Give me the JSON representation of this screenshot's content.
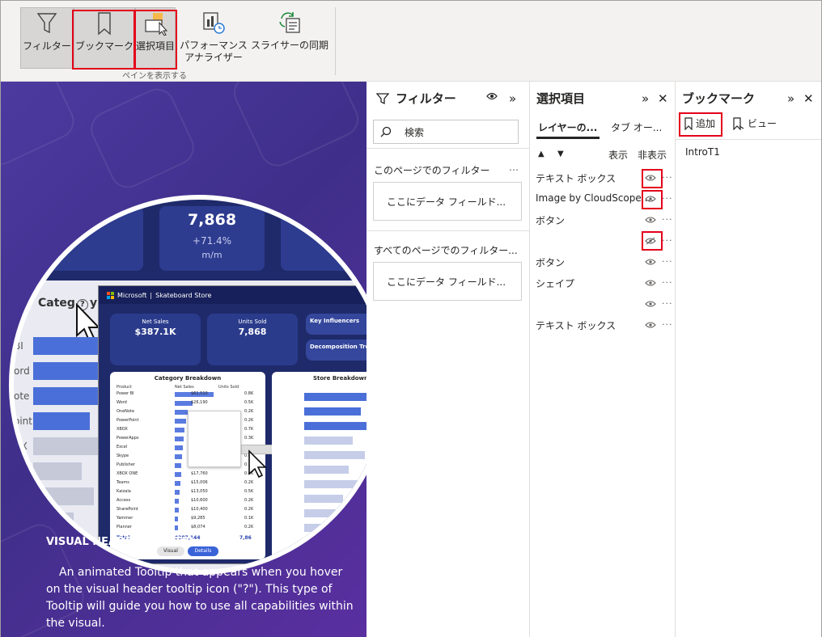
{
  "ribbon": {
    "buttons": [
      {
        "label": "フィルター"
      },
      {
        "label": "ブックマーク"
      },
      {
        "label": "選択項目"
      },
      {
        "label": "パフォーマンス",
        "label2": "アナライザー"
      },
      {
        "label": "スライサーの同期"
      }
    ],
    "group_label": "ペインを表示する"
  },
  "canvas": {
    "kpi_value": "7,868",
    "kpi_change": "+71.4%",
    "kpi_unit": "m/m",
    "category_label": "Categ",
    "category_label_tail": "y",
    "side_labels": [
      "BI",
      "ord",
      "ote",
      "oint",
      "OX"
    ],
    "inner": {
      "brand": "Microsoft",
      "store": "Skateboard Store",
      "net_sales_label": "Net Sales",
      "net_sales_value": "$387.1K",
      "units_sold_label": "Units Sold",
      "units_sold_value": "7,868",
      "key_influencers": "Key Influencers",
      "decomp_tree": "Decomposition Tree",
      "category_breakdown": "Category Breakdown",
      "store_breakdown": "Store Breakdown",
      "col_product": "Product",
      "col_net_sales": "Net Sales",
      "col_units": "Units Sold",
      "products": [
        "Power BI",
        "Word",
        "OneNote",
        "PowerPoint",
        "XBOX",
        "PowerApps",
        "Excel",
        "Skype",
        "Publisher",
        "XBOX ONE",
        "Teams",
        "Kaizala",
        "Access",
        "SharePoint",
        "Yammer",
        "Planner"
      ],
      "net_values": [
        "$61,510",
        "$26,190",
        "",
        "",
        "",
        "",
        "",
        "",
        "$19,465",
        "$17,760",
        "$15,006",
        "$13,050",
        "$10,600",
        "$10,400",
        "$9,285",
        "$8,074"
      ],
      "unit_values": [
        "0.8K",
        "0.5K",
        "0.2K",
        "0.2K",
        "0.7K",
        "0.3K",
        "0.2K",
        "0.4K",
        "0.2K",
        "0.4K",
        "0.2K",
        "0.5K",
        "0.2K",
        "0.2K",
        "0.1K",
        "0.2K"
      ],
      "total_label": "Total",
      "total_net": "$387,144",
      "total_units": "7,86",
      "visual_btn": "Visual",
      "details_btn": "Details"
    },
    "visual_title": "VISUAL HEADER TOOLTIP",
    "visual_desc": "An animated Tooltip that appears when you hover on the visual header tooltip icon (\"?\"). This type of Tooltip will guide you how to use all capabilities within the visual."
  },
  "filter_pane": {
    "title": "フィルター",
    "search_placeholder": "検索",
    "section1": "このページでのフィルター",
    "section1_more": "…",
    "well1": "ここにデータ フィールド...",
    "section2": "すべてのページでのフィルター...",
    "well2": "ここにデータ フィールド..."
  },
  "selection_pane": {
    "title": "選択項目",
    "tab_layer": "レイヤーの...",
    "tab_order": "タブ オー...",
    "show_label": "表示",
    "hide_label": "非表示",
    "layers": [
      {
        "name": "テキスト ボックス",
        "visible": true
      },
      {
        "name": "Image by CloudScope ...",
        "visible": true
      },
      {
        "name": "ボタン",
        "visible": true
      },
      {
        "name": "",
        "visible": false
      },
      {
        "name": "ボタン",
        "visible": true
      },
      {
        "name": "シェイプ",
        "visible": true
      },
      {
        "name": "",
        "visible": true
      },
      {
        "name": "テキスト ボックス",
        "visible": true
      }
    ]
  },
  "bookmark_pane": {
    "title": "ブックマーク",
    "add_label": "追加",
    "view_label": "ビュー",
    "bookmarks": [
      "IntroT1"
    ]
  },
  "colors": {
    "highlight": "#e4001b",
    "accent_bar": "#4a6fd8",
    "dark_card": "#27357d"
  }
}
